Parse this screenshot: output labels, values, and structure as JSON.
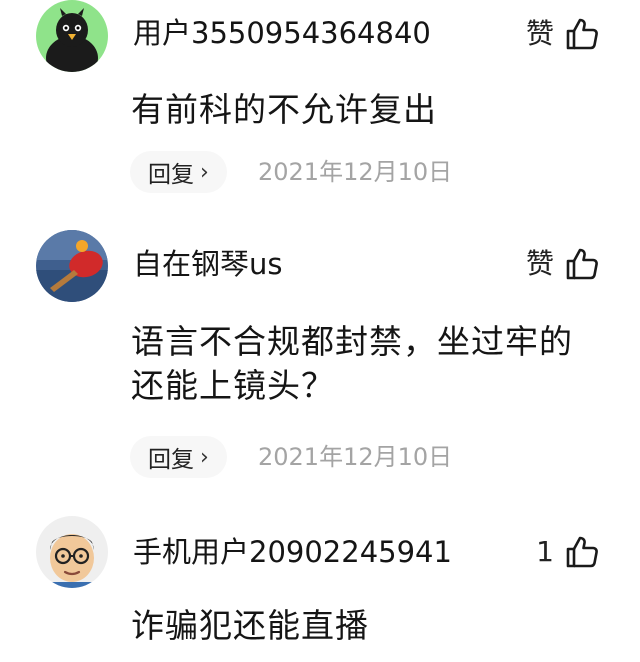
{
  "comments": [
    {
      "username": "用户3550954364840",
      "like_label": "赞",
      "text": "有前科的不允许复出",
      "reply_label": "回复",
      "reply_chevron": "›",
      "date": "2021年12月10日",
      "avatar": "cartoon-penguin-avatar"
    },
    {
      "username": "自在钢琴us",
      "like_label": "赞",
      "text": "语言不合规都封禁，坐过牢的还能上镜头？",
      "reply_label": "回复",
      "reply_chevron": "›",
      "date": "2021年12月10日",
      "avatar": "ping-pong-paddle-avatar"
    },
    {
      "username": "手机用户20902245941",
      "like_label": "1",
      "text": "诈骗犯还能直播",
      "avatar": "cartoon-man-glasses-avatar"
    }
  ],
  "colors": {
    "avatar1_bg": "#8fe38a",
    "avatar2_bg": "#3f5f8e",
    "paddle_red": "#d12a2a",
    "ball_orange": "#f4a62a",
    "date_gray": "#a4a4a4",
    "reply_bg": "#f7f7f7"
  }
}
